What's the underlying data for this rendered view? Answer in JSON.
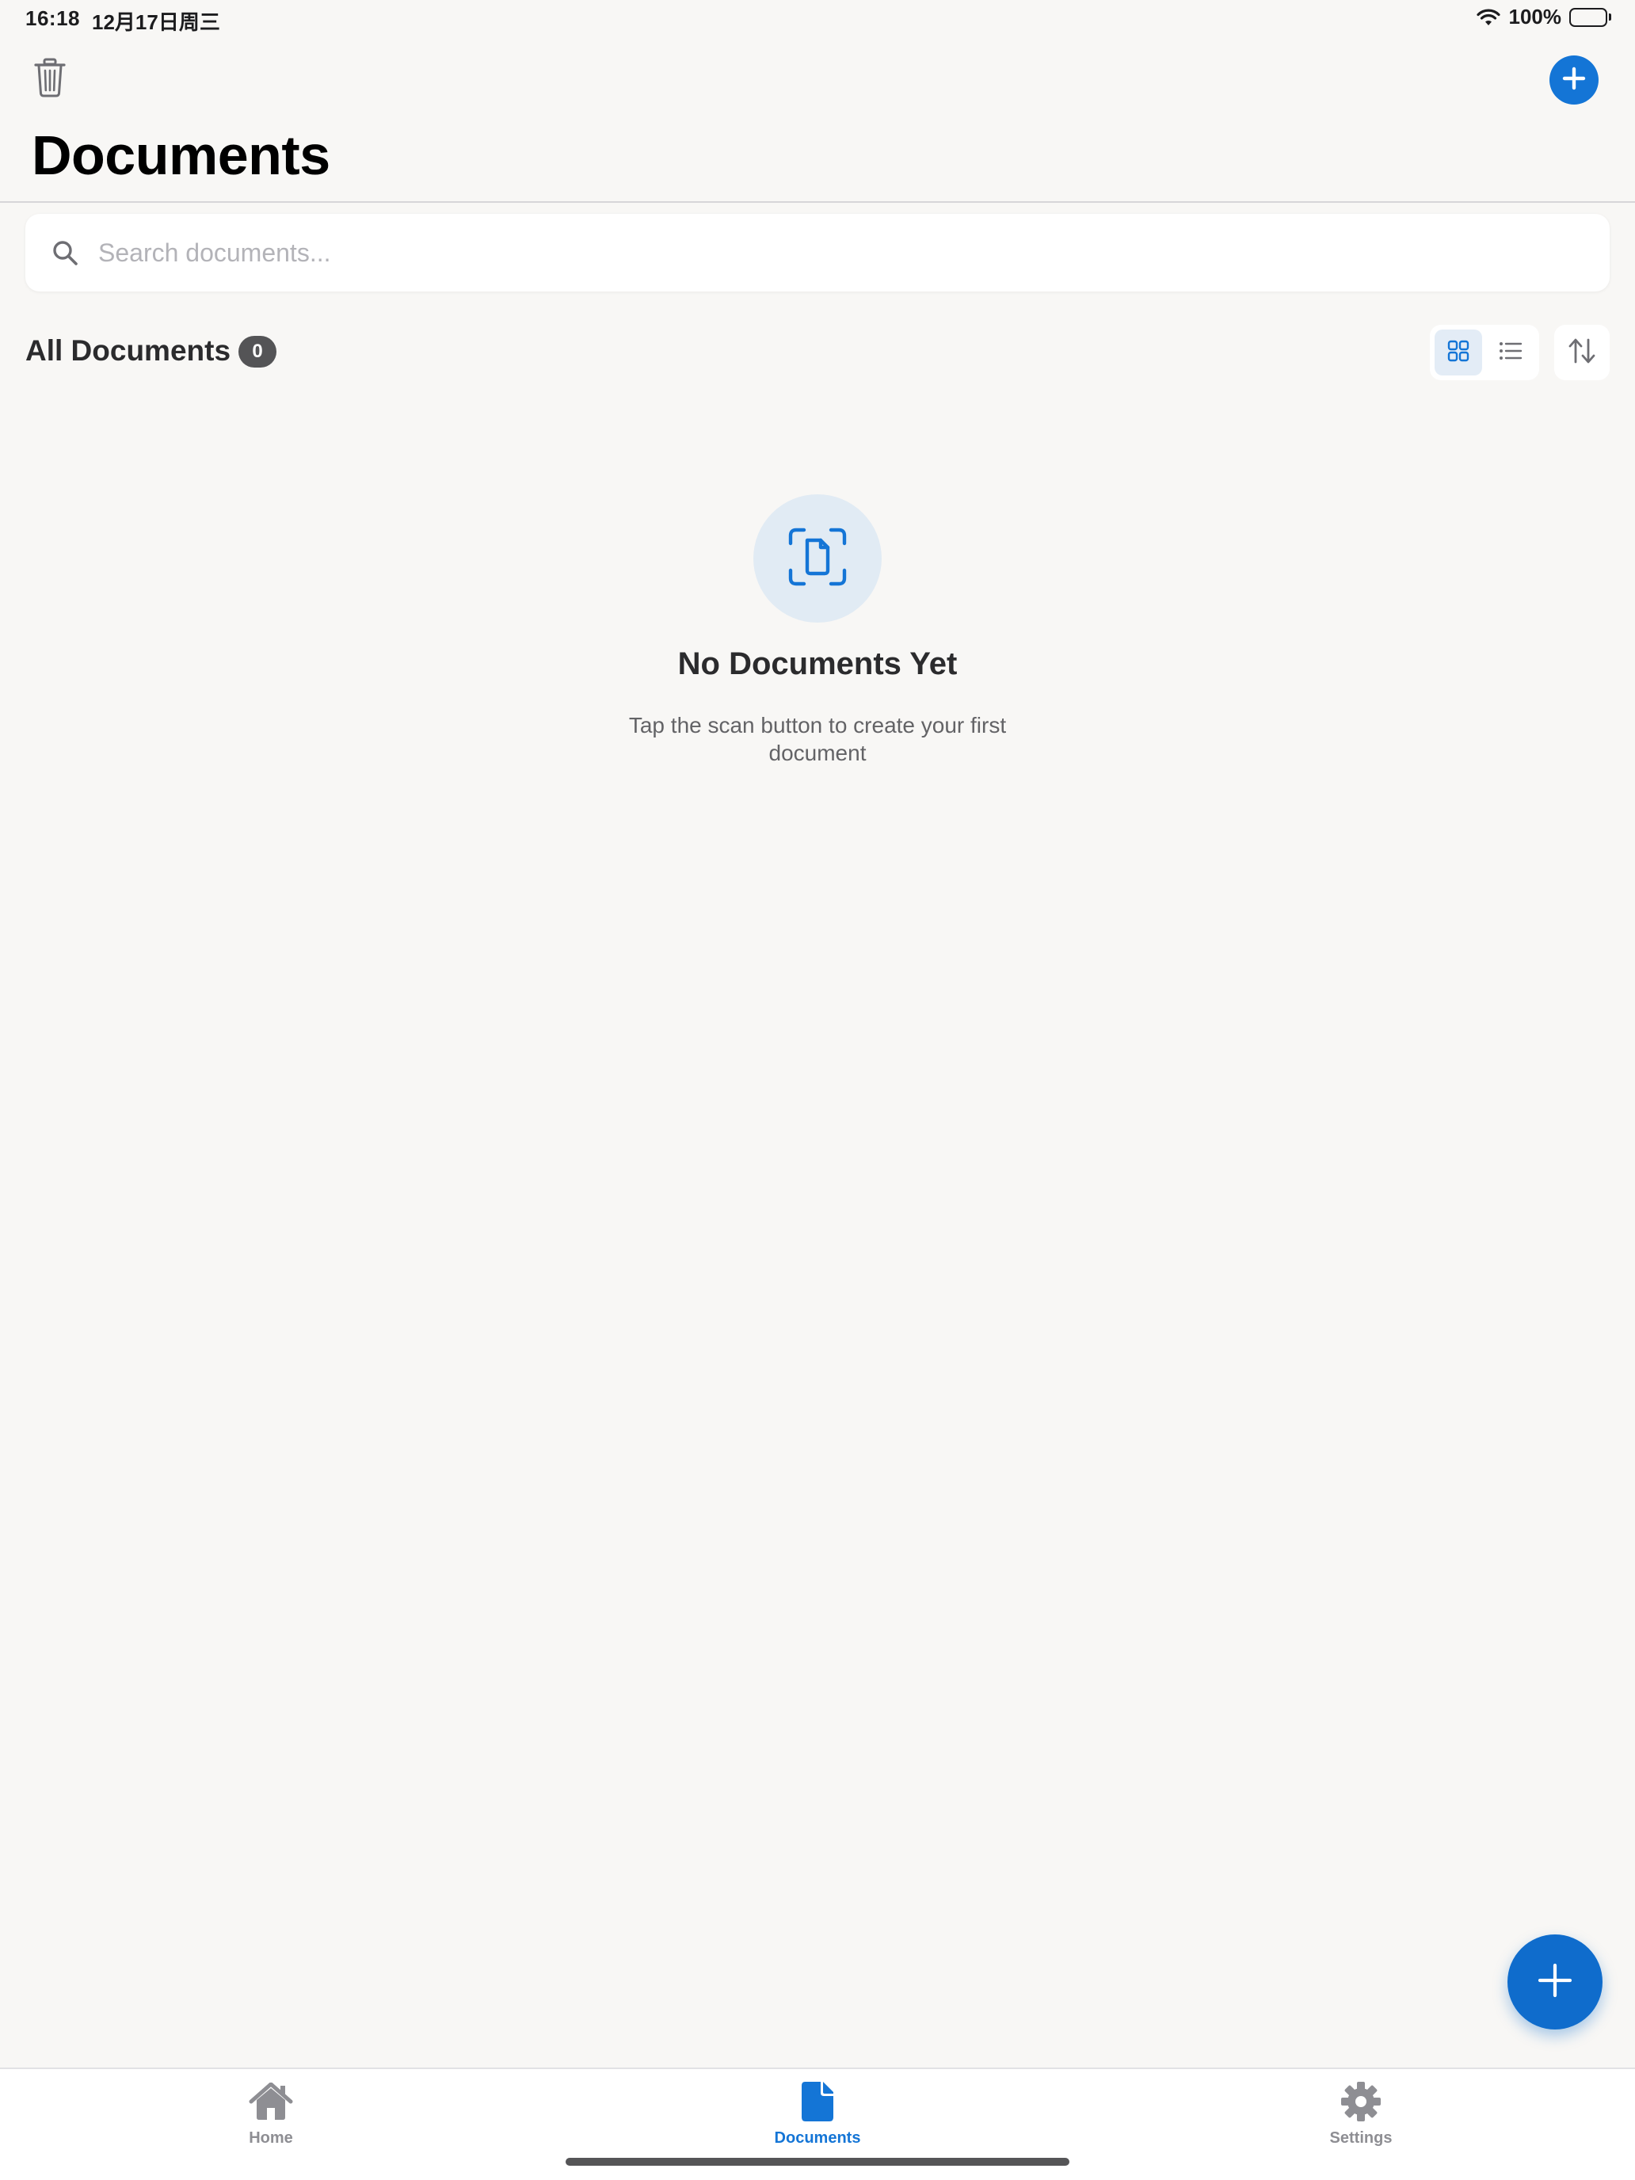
{
  "status_bar": {
    "time": "16:18",
    "date": "12月17日周三",
    "battery": "100%"
  },
  "header": {
    "title": "Documents"
  },
  "search": {
    "placeholder": "Search documents..."
  },
  "section": {
    "title": "All Documents",
    "count": "0"
  },
  "empty_state": {
    "title": "No Documents Yet",
    "subtitle": "Tap the scan button to create your first document"
  },
  "tabs": [
    {
      "label": "Home",
      "icon": "house-icon"
    },
    {
      "label": "Documents",
      "icon": "document-icon",
      "active": true
    },
    {
      "label": "Settings",
      "icon": "gear-icon"
    }
  ],
  "colors": {
    "accent": "#1475d6",
    "background": "#f8f7f5",
    "inactive": "#8e8e93"
  }
}
